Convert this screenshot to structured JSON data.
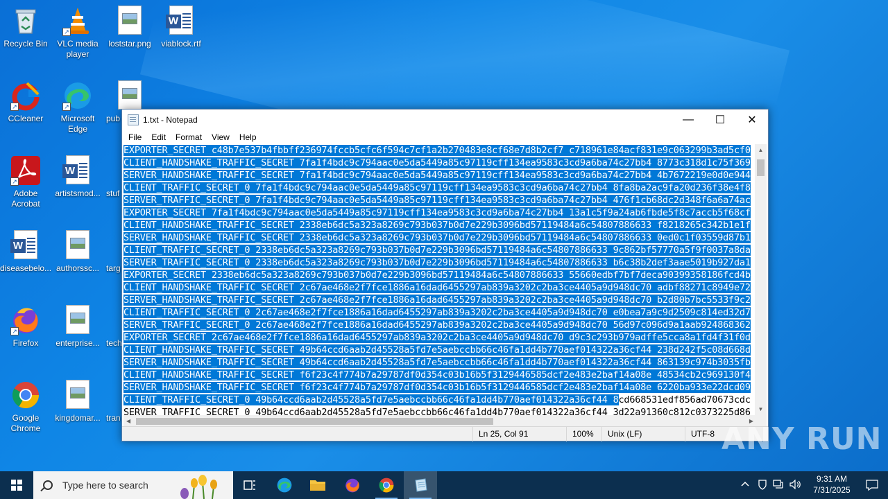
{
  "desktop": {
    "icons": [
      {
        "label": "Recycle Bin"
      },
      {
        "label": "VLC media player"
      },
      {
        "label": "loststar.png"
      },
      {
        "label": "viablock.rtf"
      },
      {
        "label": "CCleaner"
      },
      {
        "label": "Microsoft Edge"
      },
      {
        "label": "pub"
      },
      {
        "label": "Adobe Acrobat"
      },
      {
        "label": "artistsmod..."
      },
      {
        "label": "stuf"
      },
      {
        "label": "diseasebelo..."
      },
      {
        "label": "authorssc..."
      },
      {
        "label": "targ"
      },
      {
        "label": "Firefox"
      },
      {
        "label": "enterprise..."
      },
      {
        "label": "tech"
      },
      {
        "label": "Google Chrome"
      },
      {
        "label": "kingdomar..."
      },
      {
        "label": "tran"
      }
    ],
    "watermark": "ANY RUN"
  },
  "notepad": {
    "title": "1.txt - Notepad",
    "menu": [
      "File",
      "Edit",
      "Format",
      "View",
      "Help"
    ],
    "lines": [
      "EXPORTER_SECRET c48b7e537b4fbbff236974fccb5cfc6f594c7cf1a2b270483e8cf68e7d8b2cf7 c718961e84acf831e9c063299b3ad5cf0",
      "CLIENT_HANDSHAKE_TRAFFIC_SECRET 7fa1f4bdc9c794aac0e5da5449a85c97119cff134ea9583c3cd9a6ba74c27bb4 8773c318d1c75f369",
      "SERVER_HANDSHAKE_TRAFFIC_SECRET 7fa1f4bdc9c794aac0e5da5449a85c97119cff134ea9583c3cd9a6ba74c27bb4 4b7672219e0d0e944",
      "CLIENT_TRAFFIC_SECRET_0 7fa1f4bdc9c794aac0e5da5449a85c97119cff134ea9583c3cd9a6ba74c27bb4 8fa8ba2ac9fa20d236f38e4f8",
      "SERVER_TRAFFIC_SECRET_0 7fa1f4bdc9c794aac0e5da5449a85c97119cff134ea9583c3cd9a6ba74c27bb4 476f1cb68dc2d348f6a6a74ac",
      "EXPORTER_SECRET 7fa1f4bdc9c794aac0e5da5449a85c97119cff134ea9583c3cd9a6ba74c27bb4 13a1c5f9a24ab6fbde5f8c7accb5f68cf",
      "CLIENT_HANDSHAKE_TRAFFIC_SECRET 2338eb6dc5a323a8269c793b037b0d7e229b3096bd57119484a6c54807886633 f8218265c342b1e1f",
      "SERVER_HANDSHAKE_TRAFFIC_SECRET 2338eb6dc5a323a8269c793b037b0d7e229b3096bd57119484a6c54807886633 0ed0c1f03559d87b1",
      "CLIENT_TRAFFIC_SECRET_0 2338eb6dc5a323a8269c793b037b0d7e229b3096bd57119484a6c54807886633 9c862bf57770a5f9f0037a8da",
      "SERVER_TRAFFIC_SECRET_0 2338eb6dc5a323a8269c793b037b0d7e229b3096bd57119484a6c54807886633 b6c38b2def3aae5019b927da1",
      "EXPORTER_SECRET 2338eb6dc5a323a8269c793b037b0d7e229b3096bd57119484a6c54807886633 55660edbf7bf7deca90399358186fcd4b",
      "CLIENT_HANDSHAKE_TRAFFIC_SECRET 2c67ae468e2f7fce1886a16dad6455297ab839a3202c2ba3ce4405a9d948dc70 adbf88271c8949e72",
      "SERVER_HANDSHAKE_TRAFFIC_SECRET 2c67ae468e2f7fce1886a16dad6455297ab839a3202c2ba3ce4405a9d948dc70 b2d80b7bc5533f9c2",
      "CLIENT_TRAFFIC_SECRET_0 2c67ae468e2f7fce1886a16dad6455297ab839a3202c2ba3ce4405a9d948dc70 e0bea7a9c9d2509c814ed32d7",
      "SERVER_TRAFFIC_SECRET_0 2c67ae468e2f7fce1886a16dad6455297ab839a3202c2ba3ce4405a9d948dc70 56d97c096d9a1aab924868362",
      "EXPORTER_SECRET 2c67ae468e2f7fce1886a16dad6455297ab839a3202c2ba3ce4405a9d948dc70 d9c3c293b979adffe5cca8a1fd4f31f0d",
      "CLIENT_HANDSHAKE_TRAFFIC_SECRET 49b64ccd6aab2d45528a5fd7e5aebccbb66c46fa1dd4b770aef014322a36cf44 238d242f5c08d668d",
      "SERVER_HANDSHAKE_TRAFFIC_SECRET 49b64ccd6aab2d45528a5fd7e5aebccbb66c46fa1dd4b770aef014322a36cf44 863139c974b3035fb",
      "CLIENT_HANDSHAKE_TRAFFIC_SECRET f6f23c4f774b7a29787df0d354c03b16b5f3129446585dcf2e483e2baf14a08e 48534cb2c969130f4",
      "SERVER_HANDSHAKE_TRAFFIC_SECRET f6f23c4f774b7a29787df0d354c03b16b5f3129446585dcf2e483e2baf14a08e 6220ba933e22dcd09"
    ],
    "last_line_selected": "CLIENT_TRAFFIC_SECRET_0 49b64ccd6aab2d45528a5fd7e5aebccbb66c46fa1dd4b770aef014322a36cf44 8",
    "last_line_unselected": "cd668531edf856ad70673cdc",
    "partial_line": "SERVER_TRAFFIC_SECRET_0 49b64ccd6aab2d45528a5fd7e5aebccbb66c46fa1dd4b770aef014322a36cf44 3d22a91360c812c0373225d86",
    "status": {
      "position": "Ln 25, Col 91",
      "zoom": "100%",
      "line_ending": "Unix (LF)",
      "encoding": "UTF-8"
    }
  },
  "taskbar": {
    "search_placeholder": "Type here to search",
    "time": "9:31 AM",
    "date": "7/31/2025"
  },
  "colors": {
    "selection": "#0078d7",
    "taskbar": "#0c2f4f"
  }
}
